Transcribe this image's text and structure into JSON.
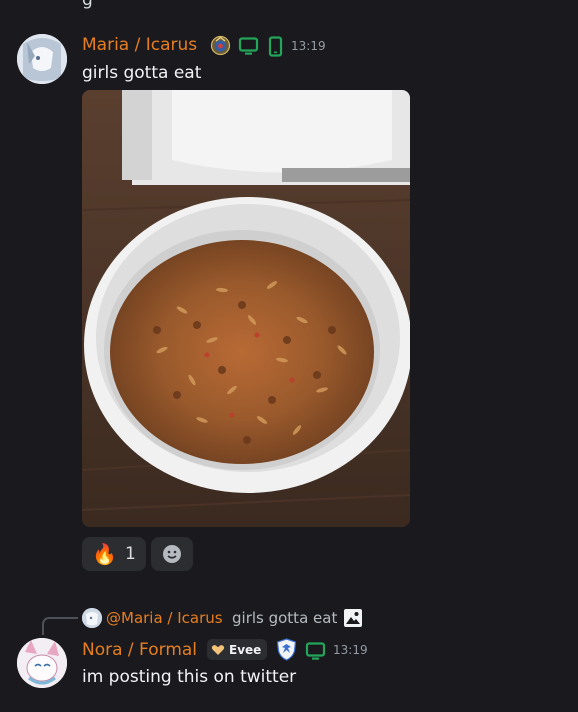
{
  "message1": {
    "author": "Maria / Icarus",
    "timestamp": "13:19",
    "text": "girls gotta eat",
    "badges": [
      "crest-icon",
      "desktop-icon",
      "mobile-icon"
    ],
    "attachment": "food-photo",
    "reactions": [
      {
        "emoji": "🔥",
        "count": "1"
      },
      {
        "emoji": "add-reaction-icon",
        "count": ""
      }
    ]
  },
  "message2": {
    "reply": {
      "author": "@Maria / Icarus",
      "text": "girls gotta eat",
      "icon": "image-icon"
    },
    "author": "Nora / Formal",
    "tag": "Evee",
    "timestamp": "13:19",
    "text": "im posting this on twitter",
    "badges": [
      "shield-icon",
      "desktop-icon"
    ]
  },
  "colors": {
    "background": "#1a1a1e",
    "author_name": "#e67e22",
    "status_green": "#23a55a",
    "reaction_bg": "#2b2d31"
  }
}
